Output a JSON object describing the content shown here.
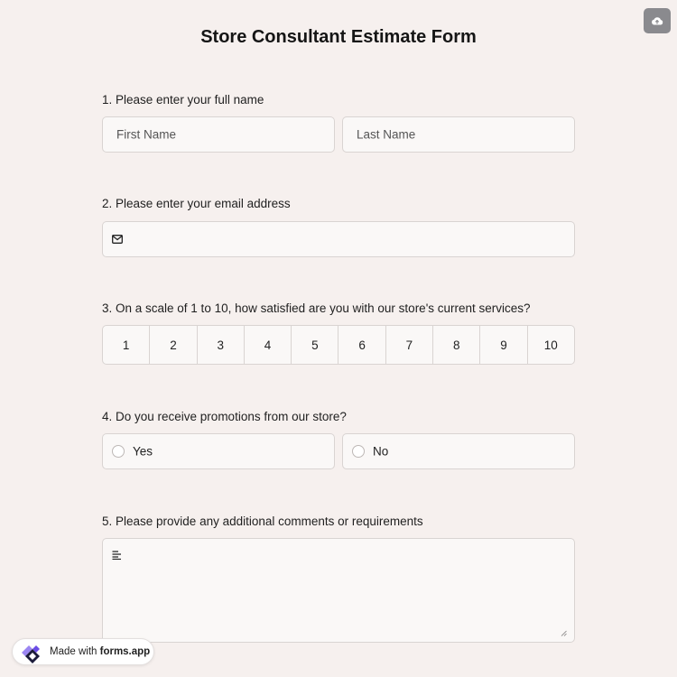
{
  "form": {
    "title": "Store Consultant Estimate Form"
  },
  "toolbar": {
    "save_icon": "cloud-upload-icon"
  },
  "questions": {
    "q1": {
      "label": "1.  Please enter your full name",
      "first_placeholder": "First Name",
      "last_placeholder": "Last Name"
    },
    "q2": {
      "label": "2. Please enter your email address",
      "icon": "mail-icon",
      "value": ""
    },
    "q3": {
      "label": "3. On a scale of 1 to 10, how satisfied are you with our store's current services?",
      "options": [
        "1",
        "2",
        "3",
        "4",
        "5",
        "6",
        "7",
        "8",
        "9",
        "10"
      ]
    },
    "q4": {
      "label": "4. Do you receive promotions from our store?",
      "options": [
        "Yes",
        "No"
      ]
    },
    "q5": {
      "label": "5. Please provide any additional comments or requirements",
      "icon": "text-lines-icon",
      "value": ""
    }
  },
  "footer": {
    "badge_prefix": "Made with ",
    "badge_brand": "forms.app"
  },
  "colors": {
    "background": "#f6f0ee",
    "field_bg": "#faf8f7",
    "border": "#d9d4d2",
    "save_button": "#8a8a8e",
    "brand_purple": "#6b4ce6"
  }
}
